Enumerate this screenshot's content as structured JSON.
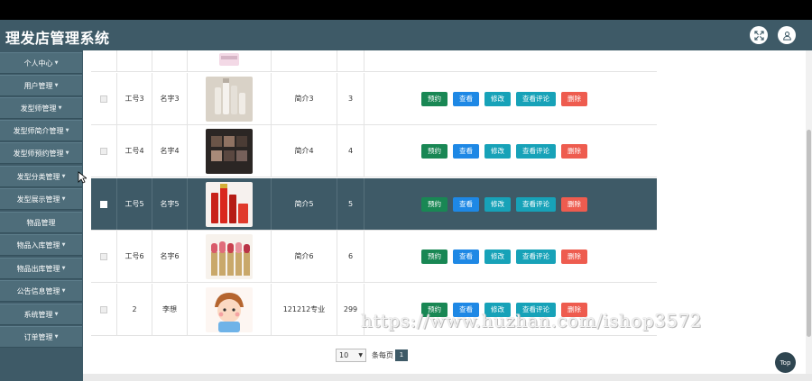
{
  "app": {
    "title": "理发店管理系统"
  },
  "header": {
    "fullscreen_icon": "fullscreen-icon",
    "user_icon": "user-icon"
  },
  "sidebar": {
    "items": [
      {
        "label": "个人中心"
      },
      {
        "label": "用户管理"
      },
      {
        "label": "发型师管理"
      },
      {
        "label": "发型师简介管理"
      },
      {
        "label": "发型师预约管理"
      },
      {
        "label": "发型分类管理"
      },
      {
        "label": "发型展示管理"
      },
      {
        "label": "物品管理"
      },
      {
        "label": "物品入库管理"
      },
      {
        "label": "物品出库管理"
      },
      {
        "label": "公告信息管理"
      },
      {
        "label": "系统管理"
      },
      {
        "label": "订单管理"
      }
    ]
  },
  "table": {
    "buttons": {
      "book": "预约",
      "view": "查看",
      "edit": "修改",
      "review": "查看评论",
      "delete": "删除"
    },
    "rows": [
      {
        "num": "工号3",
        "name": "名字3",
        "intro": "简介3",
        "count": "3",
        "image": "skincare-bottles",
        "selected": false
      },
      {
        "num": "工号4",
        "name": "名字4",
        "intro": "简介4",
        "count": "4",
        "image": "eyeshadow-palette",
        "selected": false
      },
      {
        "num": "工号5",
        "name": "名字5",
        "intro": "简介5",
        "count": "5",
        "image": "red-cosmetics-set",
        "selected": true
      },
      {
        "num": "工号6",
        "name": "名字6",
        "intro": "简介6",
        "count": "6",
        "image": "lipsticks",
        "selected": false
      },
      {
        "num": "2",
        "name": "李想",
        "intro": "121212专业",
        "count": "299",
        "image": "cartoon-boy",
        "selected": false
      }
    ]
  },
  "pager": {
    "page_size": "10",
    "page_size_label": "条每页",
    "current_page": "1"
  },
  "top_button": "Top",
  "watermark": "https://www.huzhan.com/ishop3572"
}
